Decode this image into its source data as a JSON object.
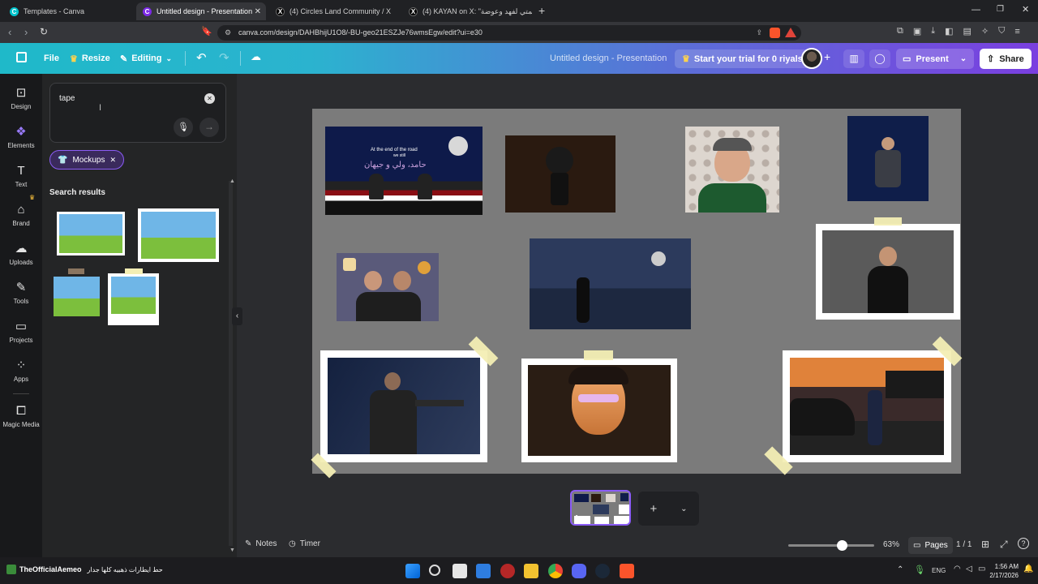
{
  "browser": {
    "tabs": [
      {
        "title": "Templates - Canva",
        "active": false
      },
      {
        "title": "Untitled design - Presentation",
        "active": true
      },
      {
        "title": "(4) Circles Land Community / X",
        "active": false
      },
      {
        "title": "(4) KAYAN on X: \"رسمتي لفهد وعوضة ✏️",
        "active": false
      }
    ],
    "url": "canva.com/design/DAHBhijU1O8/-BU-geo21ESZJe76wmsEgw/edit?ui=e30"
  },
  "header": {
    "file_label": "File",
    "resize_label": "Resize",
    "editing_label": "Editing",
    "doc_title": "Untitled design - Presentation",
    "trial_label": "Start your trial for 0 riyals",
    "present_label": "Present",
    "share_label": "Share"
  },
  "rail": {
    "items": [
      {
        "label": "Design",
        "icon": "layout-icon"
      },
      {
        "label": "Elements",
        "icon": "shapes-icon"
      },
      {
        "label": "Text",
        "icon": "text-icon"
      },
      {
        "label": "Brand",
        "icon": "brand-icon"
      },
      {
        "label": "Uploads",
        "icon": "upload-cloud-icon"
      },
      {
        "label": "Tools",
        "icon": "pen-icon"
      },
      {
        "label": "Projects",
        "icon": "folder-icon"
      },
      {
        "label": "Apps",
        "icon": "apps-grid-icon"
      },
      {
        "label": "Magic Media",
        "icon": "magic-media-icon"
      }
    ]
  },
  "panel": {
    "search_value": "tape",
    "filter_chip": "Mockups",
    "results_heading": "Search results"
  },
  "footer": {
    "notes_label": "Notes",
    "timer_label": "Timer",
    "zoom": "63%",
    "pages_label": "Pages",
    "page_count": "1 / 1",
    "zoom_fraction": 0.63
  },
  "canvas": {
    "poster_text_line1": "At the end of the road",
    "poster_text_line2": "we still",
    "poster_arabic": "حامد، ولي و جيهان"
  },
  "taskbar": {
    "left_text": "TheOfficialAemeo",
    "left_arabic": "حط ايطارات ذهبيه كلها جدار",
    "lang": "ENG",
    "time": "1:56 AM",
    "date": "2/17/2026"
  },
  "colors": {
    "header_start": "#1fb9c9",
    "header_end": "#7a3fe0",
    "canvas_bg": "#7b7b7b",
    "workspace_bg": "#2b2c2f",
    "chip_accent": "#8b5cf6"
  }
}
